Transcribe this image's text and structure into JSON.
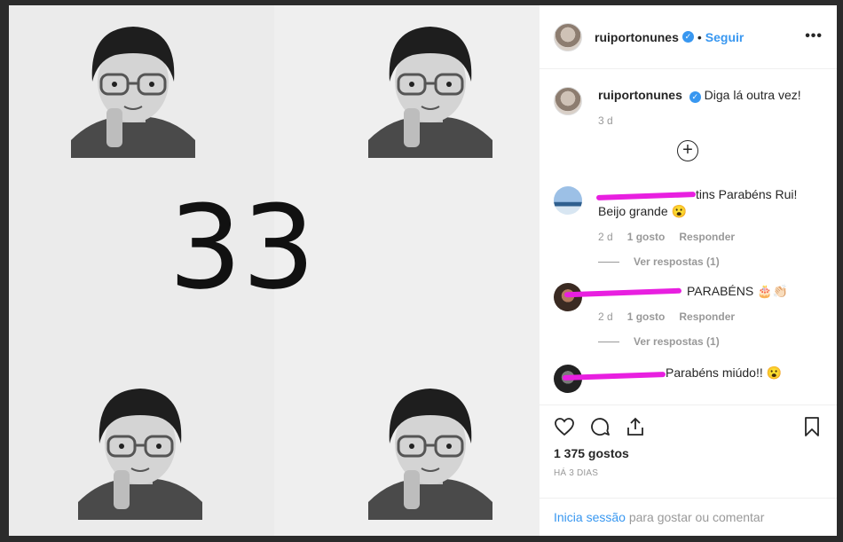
{
  "header": {
    "username": "ruiportonunes",
    "dot": "•",
    "follow_label": "Seguir",
    "more": "•••"
  },
  "photo": {
    "big_number": "33"
  },
  "caption": {
    "username": "ruiportonunes",
    "text": "Diga lá outra vez!",
    "time": "3 d"
  },
  "comments": [
    {
      "text": "tins Parabéns Rui! Beijo grande 😮",
      "time": "2 d",
      "likes": "1 gosto",
      "reply": "Responder",
      "view_replies": "Ver respostas (1)"
    },
    {
      "text": "PARABÉNS 🎂👏🏻",
      "time": "2 d",
      "likes": "1 gosto",
      "reply": "Responder",
      "view_replies": "Ver respostas (1)"
    },
    {
      "text": "Parabéns miúdo!! 😮"
    }
  ],
  "actions": {
    "likes_count": "1 375 gostos",
    "date": "HÁ 3 DIAS"
  },
  "login": {
    "link": "Inicia sessão",
    "rest": " para gostar ou comentar"
  },
  "colors": {
    "accent": "#3897f0",
    "scribble": "#e81fe0",
    "muted": "#999999",
    "text": "#262626"
  }
}
